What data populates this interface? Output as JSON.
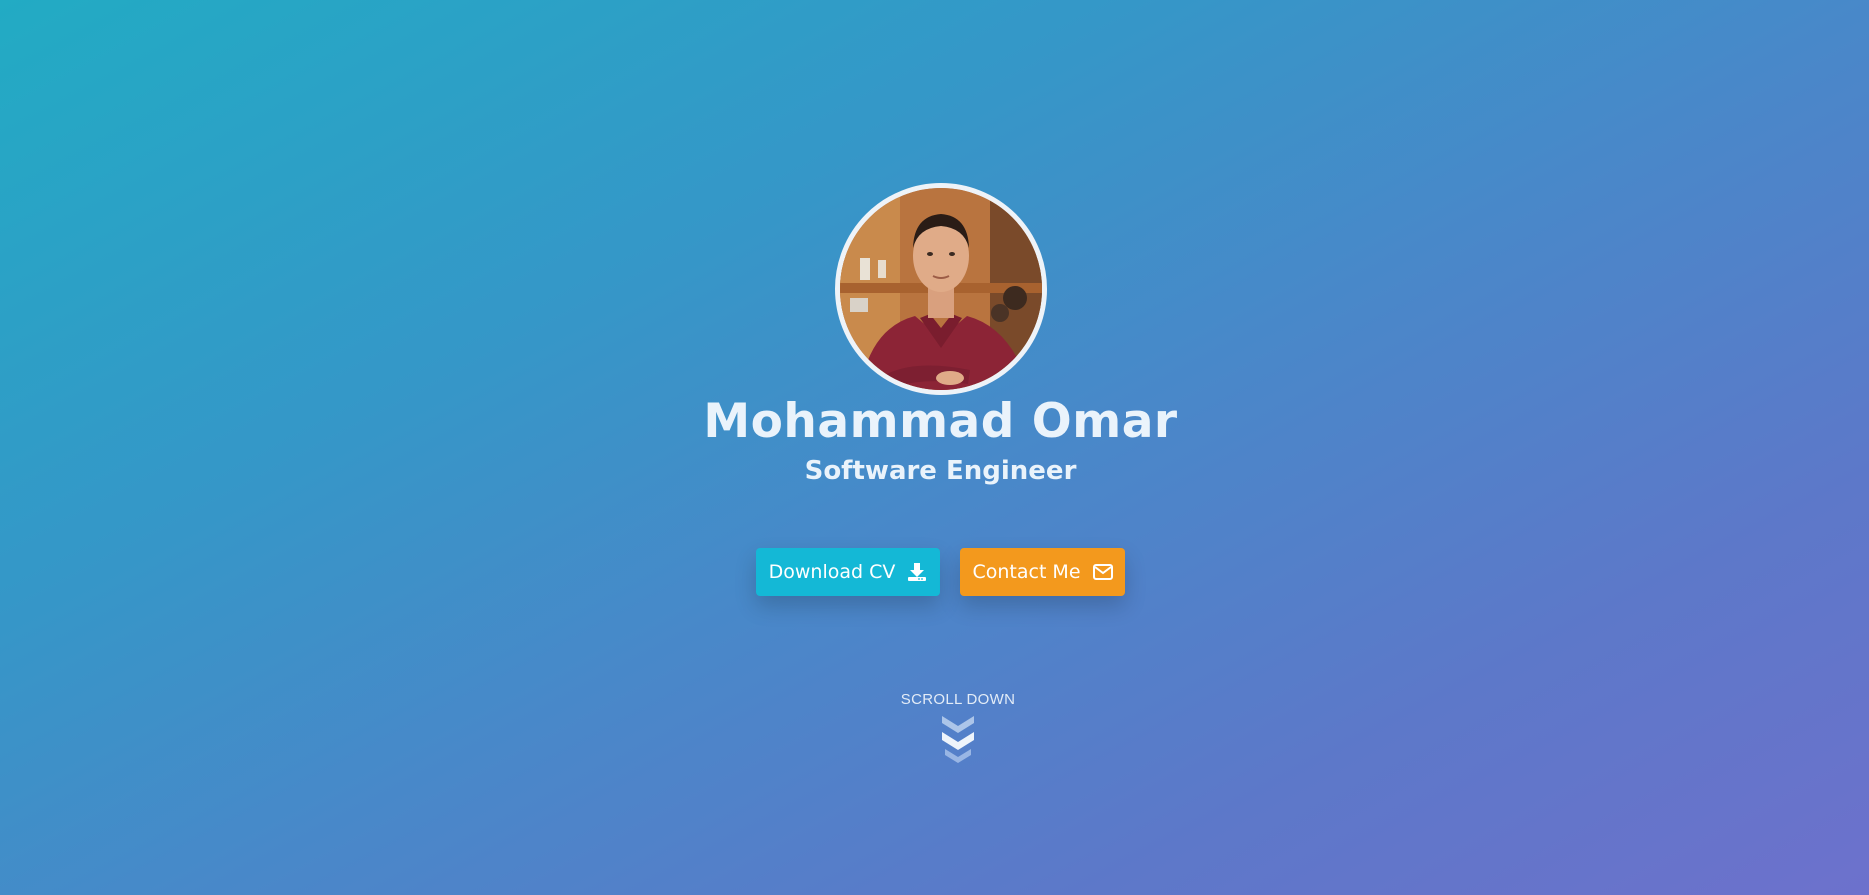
{
  "profile": {
    "name": "Mohammad Omar",
    "title": "Software Engineer",
    "avatar_alt": "profile-photo"
  },
  "actions": {
    "download_cv": {
      "label": "Download CV",
      "icon": "download-icon",
      "color": "#14b8d6"
    },
    "contact": {
      "label": "Contact Me",
      "icon": "envelope-icon",
      "color": "#f3991d"
    }
  },
  "scroll": {
    "label": "SCROLL DOWN",
    "icon": "chevrons-down-icon"
  },
  "colors": {
    "gradient_start": "#22abc4",
    "gradient_end": "#6d71cc",
    "text": "#eaf3fb"
  }
}
